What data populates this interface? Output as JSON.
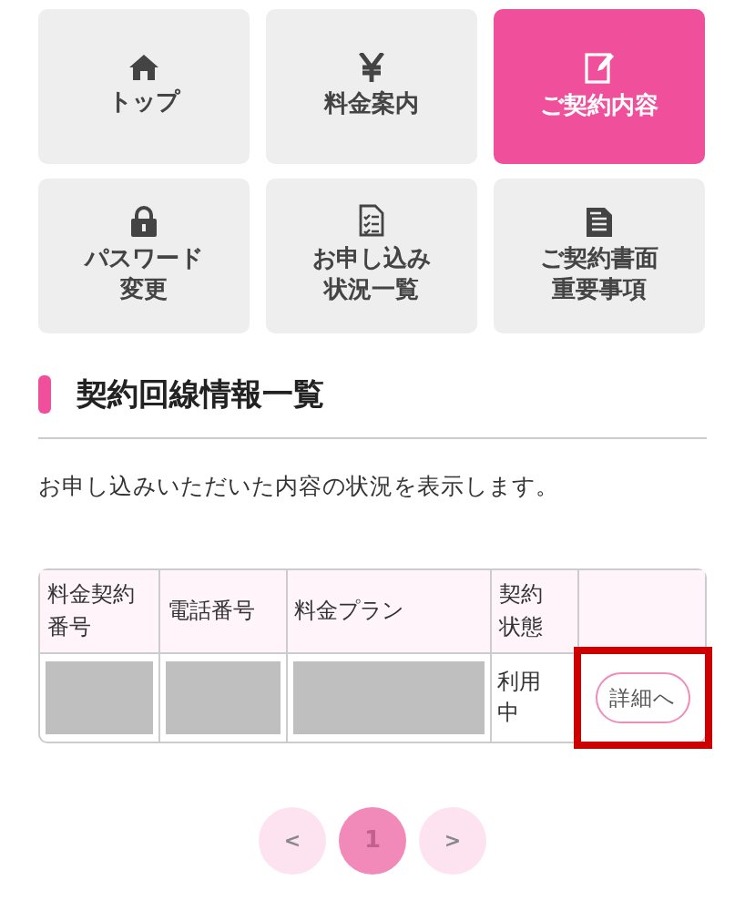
{
  "menu": [
    {
      "label": [
        "トップ"
      ],
      "selected": false
    },
    {
      "label": [
        "料金案内"
      ],
      "selected": false
    },
    {
      "label": [
        "ご契約内容"
      ],
      "selected": true
    },
    {
      "label": [
        "パスワード",
        "変更"
      ],
      "selected": false
    },
    {
      "label": [
        "お申し込み",
        "状況一覧"
      ],
      "selected": false
    },
    {
      "label": [
        "ご契約書面",
        "重要事項"
      ],
      "selected": false
    }
  ],
  "section": {
    "title": "契約回線情報一覧",
    "description": "お申し込みいただいた内容の状況を表示します。"
  },
  "table": {
    "columns": [
      "料金契約番号",
      "電話番号",
      "料金プラン",
      "契約状態",
      ""
    ],
    "rows": [
      {
        "cells": [
          {
            "kind": "redacted"
          },
          {
            "kind": "redacted"
          },
          {
            "kind": "redacted"
          },
          {
            "kind": "text",
            "text": "利用中"
          },
          {
            "kind": "button",
            "text": "詳細へ",
            "highlighted": true
          }
        ]
      }
    ]
  },
  "pagination": [
    {
      "label": "<",
      "kind": "prev",
      "selected": false
    },
    {
      "label": "1",
      "kind": "page",
      "selected": true
    },
    {
      "label": ">",
      "kind": "next",
      "selected": false
    }
  ]
}
